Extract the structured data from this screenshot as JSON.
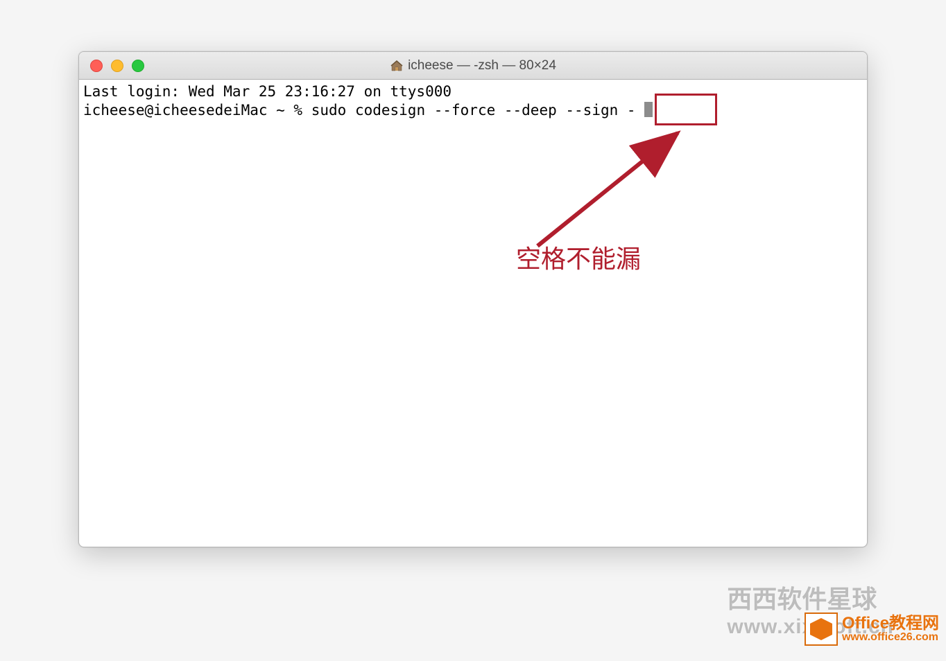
{
  "titlebar": {
    "home_icon": "home-icon",
    "title": "icheese — -zsh — 80×24"
  },
  "terminal": {
    "line1": "Last login: Wed Mar 25 23:16:27 on ttys000",
    "prompt": "icheese@icheesedeiMac ~ % ",
    "command": "sudo codesign --force --deep --sign - "
  },
  "annotation": {
    "label": "空格不能漏"
  },
  "watermark1": {
    "line1": "西西软件星球",
    "line2": "www.xixisoft.cn"
  },
  "watermark2": {
    "line1": "Office教程网",
    "line2": "www.office26.com"
  },
  "colors": {
    "annotation": "#b01e2d",
    "watermark2": "#e8730f"
  }
}
